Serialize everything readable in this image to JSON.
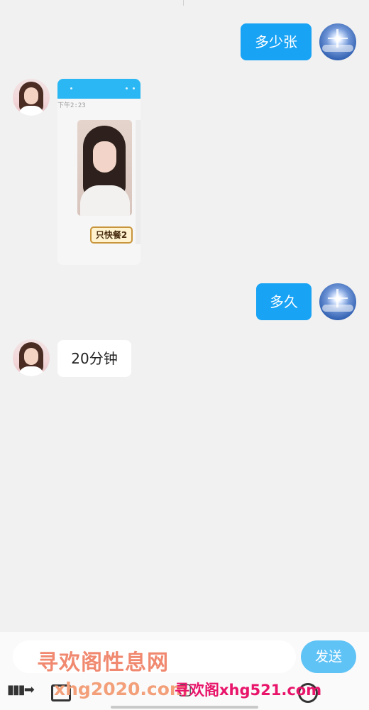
{
  "messages": [
    {
      "direction": "out",
      "text": "多少张",
      "avatar": "sky-avatar"
    },
    {
      "direction": "in",
      "type": "image",
      "avatar": "girl-avatar",
      "image": {
        "time": "下午2:23",
        "sticker_text": "只快餐2"
      }
    },
    {
      "direction": "out",
      "text": "多久",
      "avatar": "sky-avatar"
    },
    {
      "direction": "in",
      "text": "20分钟",
      "avatar": "girl-avatar"
    }
  ],
  "input_bar": {
    "placeholder": "",
    "send_label": "发送",
    "watermark_main": "寻欢阁性息网"
  },
  "toolbar": {
    "items": [
      "voice-icon",
      "photo-icon",
      "camera-icon",
      "emoji-icon"
    ]
  },
  "watermarks": {
    "site_a": "xhg2020.com",
    "site_b": "寻欢阁xhg521.com"
  },
  "colors": {
    "outgoing_bubble": "#18a3f5",
    "incoming_bubble": "#ffffff",
    "background": "#f1f1f1",
    "send_button": "#60c3f6"
  }
}
